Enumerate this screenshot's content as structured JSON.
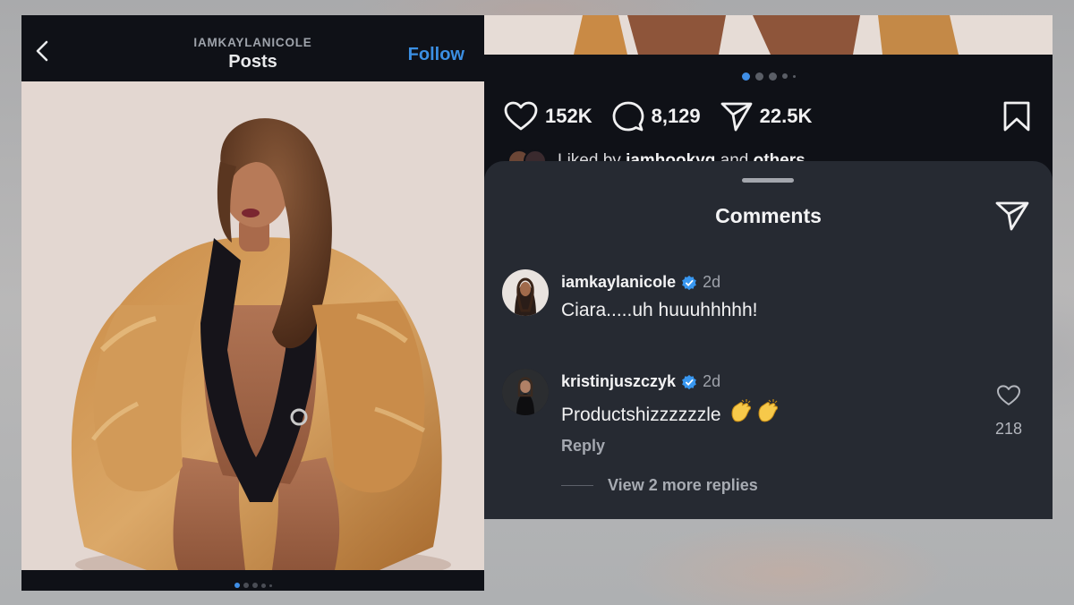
{
  "left_post": {
    "header": {
      "username": "IAMKAYLANICOLE",
      "title": "Posts",
      "follow_label": "Follow"
    },
    "carousel": {
      "count": 5,
      "active_index": 0
    }
  },
  "right_post": {
    "carousel": {
      "count": 5,
      "active_index": 0
    },
    "actions": {
      "likes": "152K",
      "comments": "8,129",
      "shares": "22.5K"
    },
    "liked_by": {
      "prefix": "Liked by",
      "user": "iamhookyg",
      "middle": "and",
      "suffix": "others"
    }
  },
  "comments_sheet": {
    "title": "Comments",
    "comments": [
      {
        "username": "iamkaylanicole",
        "verified": true,
        "time": "2d",
        "text": "Ciara.....uh huuuhhhhh!"
      },
      {
        "username": "kristinjuszczyk",
        "verified": true,
        "time": "2d",
        "text": "Productshizzzzzzle",
        "emoji": "clapping-hands",
        "reply_label": "Reply",
        "like_count": "218",
        "more_replies": "View 2 more replies"
      }
    ]
  },
  "colors": {
    "panel_bg": "#0f1117",
    "sheet_bg": "#262a32",
    "accent_blue": "#3b8fe3",
    "verified_blue": "#3897f0"
  },
  "icons": [
    "back-chevron-icon",
    "heart-icon",
    "comment-icon",
    "send-icon",
    "bookmark-icon",
    "verified-icon",
    "heart-outline-icon",
    "clapping-hands-emoji"
  ]
}
